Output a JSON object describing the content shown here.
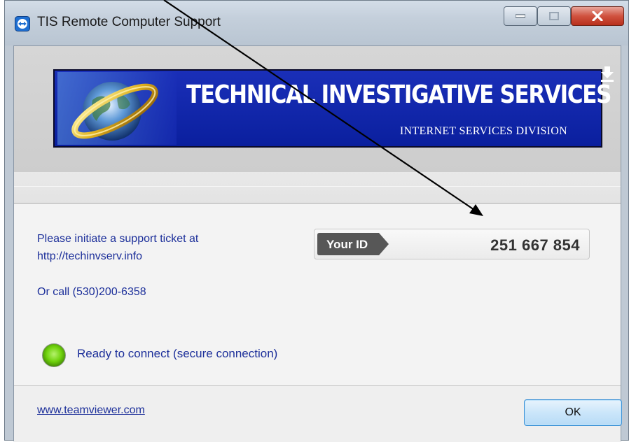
{
  "window": {
    "title": "TIS Remote Computer Support"
  },
  "banner": {
    "title": "TECHNICAL INVESTIGATIVE SERVICES",
    "subtitle": "INTERNET SERVICES DIVISION"
  },
  "info": {
    "line1": "Please initiate a support ticket at",
    "line2": "http://techinvserv.info",
    "line3": "Or call (530)200-6358"
  },
  "id_box": {
    "label": "Your ID",
    "value": "251 667 854"
  },
  "status": {
    "text": "Ready to connect (secure connection)",
    "indicator_color": "#6fd20c"
  },
  "footer": {
    "link": "www.teamviewer.com",
    "ok_label": "OK"
  },
  "icons": {
    "app": "teamviewer-icon",
    "minimize": "minimize-icon",
    "maximize": "maximize-icon",
    "close": "close-icon",
    "download": "download-icon",
    "logo": "globe-logo"
  },
  "colors": {
    "banner_background": "#0a1f9e",
    "text_blue": "#1c2f9a",
    "close_button": "#c8412c",
    "id_tag": "#555555"
  }
}
